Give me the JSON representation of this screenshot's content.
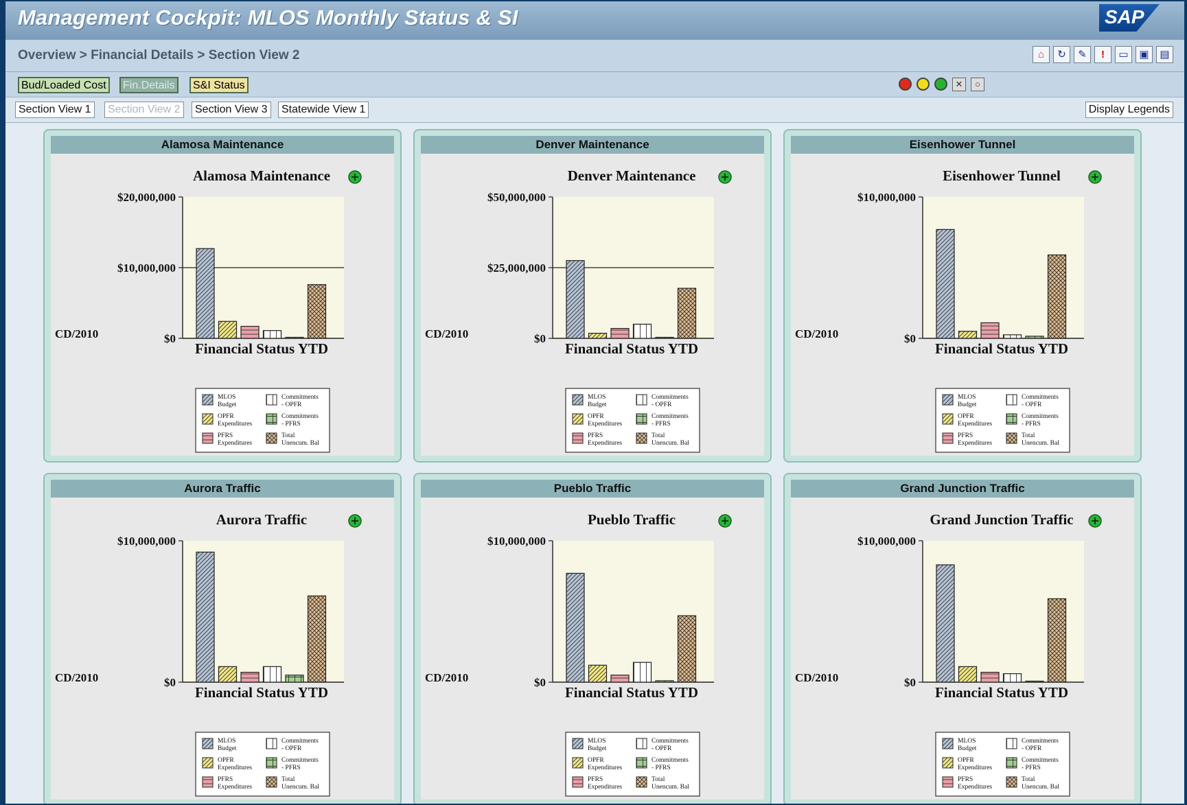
{
  "app": {
    "title": "Management Cockpit: MLOS Monthly Status & SI",
    "logo_text": "SAP"
  },
  "breadcrumb": "Overview > Financial Details > Section View 2",
  "toolbar": {
    "icons": [
      "home-icon",
      "refresh-icon",
      "edit-icon",
      "alert-icon",
      "print-icon",
      "print-preview-icon",
      "save-icon"
    ]
  },
  "nav_buttons": [
    {
      "label": "Bud/Loaded Cost",
      "active": false
    },
    {
      "label": "Fin.Details",
      "active": true
    },
    {
      "label": "S&I Status",
      "active": false
    }
  ],
  "status_lights": [
    {
      "name": "red-light-icon",
      "color": "#e02a1a"
    },
    {
      "name": "yellow-light-icon",
      "color": "#f1de1b"
    },
    {
      "name": "green-light-icon",
      "color": "#27b230"
    },
    {
      "name": "no-status-icon",
      "glyph": "✕"
    },
    {
      "name": "neutral-status-icon",
      "glyph": "○"
    }
  ],
  "tabs": [
    {
      "label": "Section View 1",
      "disabled": false
    },
    {
      "label": "Section View 2",
      "disabled": true
    },
    {
      "label": "Section View 3",
      "disabled": false
    },
    {
      "label": "Statewide View 1",
      "disabled": false
    }
  ],
  "display_legends_label": "Display Legends",
  "colors": {
    "mlos_budget": "#b4c3d6",
    "opfr_expenditures": "#f1e685",
    "pfrs_expenditures": "#e9a0a8",
    "commitments_opfr": "#ffffff",
    "commitments_pfrs": "#9fd18e",
    "total_unencum_bal": "#e3be8f",
    "plot_bg": "#f8f6e4"
  },
  "chart_data": [
    {
      "type": "bar",
      "panel_title": "Alamosa Maintenance",
      "title": "Alamosa Maintenance",
      "ytick_labels": [
        "$20,000,000",
        "$10,000,000",
        "$0"
      ],
      "ylim": [
        0,
        20000000
      ],
      "xlabel": "Financial Status YTD",
      "side_label": "CD/2010",
      "categories": [
        "MLOS Budget",
        "OPFR Expenditures",
        "PFRS Expenditures",
        "Commitments - OPFR",
        "Commitments - PFRS",
        "Total Unencum. Bal"
      ],
      "values": [
        12700000,
        2400000,
        1700000,
        1100000,
        100000,
        7600000
      ],
      "gridlines": [
        10000000
      ]
    },
    {
      "type": "bar",
      "panel_title": "Denver Maintenance",
      "title": "Denver Maintenance",
      "ytick_labels": [
        "$50,000,000",
        "$25,000,000",
        "$0"
      ],
      "ylim": [
        0,
        50000000
      ],
      "xlabel": "Financial Status YTD",
      "side_label": "CD/2010",
      "categories": [
        "MLOS Budget",
        "OPFR Expenditures",
        "PFRS Expenditures",
        "Commitments - OPFR",
        "Commitments - PFRS",
        "Total Unencum. Bal"
      ],
      "values": [
        27500000,
        1800000,
        3500000,
        5000000,
        300000,
        17700000
      ],
      "gridlines": [
        25000000
      ]
    },
    {
      "type": "bar",
      "panel_title": "Eisenhower Tunnel",
      "title": "Eisenhower Tunnel",
      "ytick_labels": [
        "$10,000,000",
        "$0"
      ],
      "ylim": [
        0,
        10000000
      ],
      "xlabel": "Financial Status YTD",
      "side_label": "CD/2010",
      "categories": [
        "MLOS Budget",
        "OPFR Expenditures",
        "PFRS Expenditures",
        "Commitments - OPFR",
        "Commitments - PFRS",
        "Total Unencum. Bal"
      ],
      "values": [
        7700000,
        500000,
        1100000,
        250000,
        150000,
        5900000
      ],
      "gridlines": []
    },
    {
      "type": "bar",
      "panel_title": "Aurora Traffic",
      "title": "Aurora Traffic",
      "ytick_labels": [
        "$10,000,000",
        "$0"
      ],
      "ylim": [
        0,
        10000000
      ],
      "xlabel": "Financial Status YTD",
      "side_label": "CD/2010",
      "categories": [
        "MLOS Budget",
        "OPFR Expenditures",
        "PFRS Expenditures",
        "Commitments - OPFR",
        "Commitments - PFRS",
        "Total Unencum. Bal"
      ],
      "values": [
        9200000,
        1100000,
        700000,
        1100000,
        500000,
        6100000
      ],
      "gridlines": []
    },
    {
      "type": "bar",
      "panel_title": "Pueblo Traffic",
      "title": "Pueblo Traffic",
      "ytick_labels": [
        "$10,000,000",
        "$0"
      ],
      "ylim": [
        0,
        10000000
      ],
      "xlabel": "Financial Status YTD",
      "side_label": "CD/2010",
      "categories": [
        "MLOS Budget",
        "OPFR Expenditures",
        "PFRS Expenditures",
        "Commitments - OPFR",
        "Commitments - PFRS",
        "Total Unencum. Bal"
      ],
      "values": [
        7700000,
        1200000,
        500000,
        1400000,
        100000,
        4700000
      ],
      "gridlines": []
    },
    {
      "type": "bar",
      "panel_title": "Grand Junction Traffic",
      "title": "Grand Junction Traffic",
      "ytick_labels": [
        "$10,000,000",
        "$0"
      ],
      "ylim": [
        0,
        10000000
      ],
      "xlabel": "Financial Status YTD",
      "side_label": "CD/2010",
      "categories": [
        "MLOS Budget",
        "OPFR Expenditures",
        "PFRS Expenditures",
        "Commitments - OPFR",
        "Commitments - PFRS",
        "Total Unencum. Bal"
      ],
      "values": [
        8300000,
        1100000,
        700000,
        600000,
        0,
        5900000
      ],
      "gridlines": []
    }
  ],
  "legend": [
    {
      "line1": "MLOS",
      "line2": "Budget",
      "pattern": "diag",
      "color_key": "mlos_budget"
    },
    {
      "line1": "OPFR",
      "line2": "Expenditures",
      "pattern": "diag",
      "color_key": "opfr_expenditures"
    },
    {
      "line1": "PFRS",
      "line2": "Expenditures",
      "pattern": "hline",
      "color_key": "pfrs_expenditures"
    },
    {
      "line1": "Commitments",
      "line2": "- OPFR",
      "pattern": "vline",
      "color_key": "commitments_opfr"
    },
    {
      "line1": "Commitments",
      "line2": "- PFRS",
      "pattern": "grid",
      "color_key": "commitments_pfrs"
    },
    {
      "line1": "Total",
      "line2": "Unencum. Bal",
      "pattern": "cross",
      "color_key": "total_unencum_bal"
    }
  ]
}
